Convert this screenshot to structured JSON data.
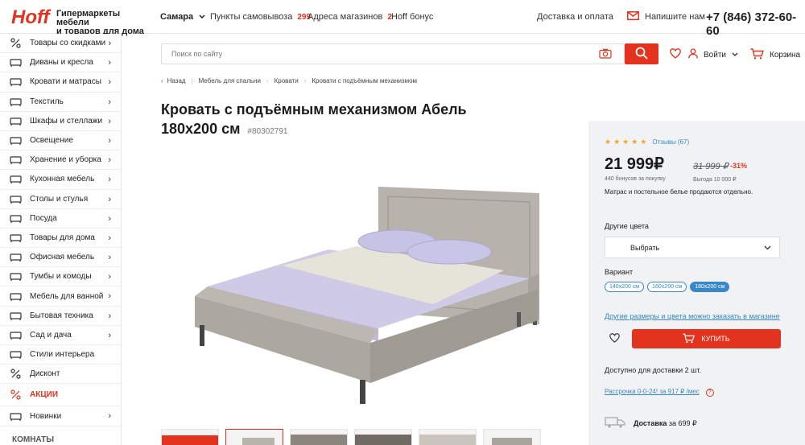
{
  "header": {
    "logo": "Hoff",
    "tagline_1": "Гипермаркеты мебели",
    "tagline_2": "и товаров для дома",
    "city": "Самара",
    "nav": [
      {
        "label": "Пункты самовывоза",
        "count": "299"
      },
      {
        "label": "Адреса магазинов",
        "count": "2"
      },
      {
        "label": "Hoff бонус",
        "count": ""
      }
    ],
    "delivery_link": "Доставка и оплата",
    "write_label": "Напишите нам",
    "phone": "+7 (846) 372-60-60"
  },
  "search": {
    "placeholder": "Поиск по сайту"
  },
  "actions": {
    "login": "Войти",
    "cart": "Корзина"
  },
  "sidebar": {
    "items": [
      {
        "label": "Товары со скидками",
        "icon": "percent-icon"
      },
      {
        "label": "Диваны и кресла",
        "icon": "sofa-icon"
      },
      {
        "label": "Кровати и матрасы",
        "icon": "bed-icon"
      },
      {
        "label": "Текстиль",
        "icon": "textile-icon"
      },
      {
        "label": "Шкафы и стеллажи",
        "icon": "wardrobe-icon"
      },
      {
        "label": "Освещение",
        "icon": "lamp-icon"
      },
      {
        "label": "Хранение и уборка",
        "icon": "storage-icon"
      },
      {
        "label": "Кухонная мебель",
        "icon": "kitchen-icon"
      },
      {
        "label": "Столы и стулья",
        "icon": "table-icon"
      },
      {
        "label": "Посуда",
        "icon": "dishes-icon"
      },
      {
        "label": "Товары для дома",
        "icon": "home-goods-icon"
      },
      {
        "label": "Офисная мебель",
        "icon": "office-chair-icon"
      },
      {
        "label": "Тумбы и комоды",
        "icon": "dresser-icon"
      },
      {
        "label": "Мебель для ванной",
        "icon": "bath-icon"
      },
      {
        "label": "Бытовая техника",
        "icon": "appliance-icon"
      },
      {
        "label": "Сад и дача",
        "icon": "garden-icon"
      },
      {
        "label": "Стили интерьера",
        "icon": "style-icon"
      },
      {
        "label": "Дисконт",
        "icon": "discount-icon"
      },
      {
        "label": "АКЦИИ",
        "icon": "sale-icon"
      },
      {
        "label": "Новинки",
        "icon": "new-icon"
      }
    ],
    "section": "КОМНАТЫ"
  },
  "breadcrumbs": [
    "Назад",
    "Мебель для спальни",
    "Кровати",
    "Кровати с подъёмным механизмом"
  ],
  "product": {
    "title_line1": "Кровать с подъёмным механизмом Абель",
    "title_line2": "180х200 см",
    "sku": "#80302791"
  },
  "buy": {
    "reviews": "Отзывы (67)",
    "rating": 5,
    "price": "21 999₽",
    "bonus": "440 бонусов за покупку",
    "old_price": "31 999 ₽",
    "discount": "-31%",
    "saving": "Выгода 10 000 ₽",
    "note": "Матрас и постельное белье продаются отдельно.",
    "colors_label": "Другие цвета",
    "select_value": "Выбрать",
    "variant_label": "Вариант",
    "variants": [
      "140х200 см",
      "160х200 см",
      "180х200 см"
    ],
    "active_variant": 2,
    "more_link": "Другие размеры и цвета можно заказать в магазине",
    "buy_label": "КУПИТЬ",
    "available": "Доступно для доставки 2 шт.",
    "credit": "Рассрочка 0-0-24! за 917 ₽ /мес",
    "credit_help": "?",
    "delivery_label": "Доставка",
    "delivery_price": "за 699 ₽"
  },
  "colors": {
    "accent": "#e3321d",
    "link": "#3a87c8",
    "panel_bg": "#f0f2f4"
  }
}
